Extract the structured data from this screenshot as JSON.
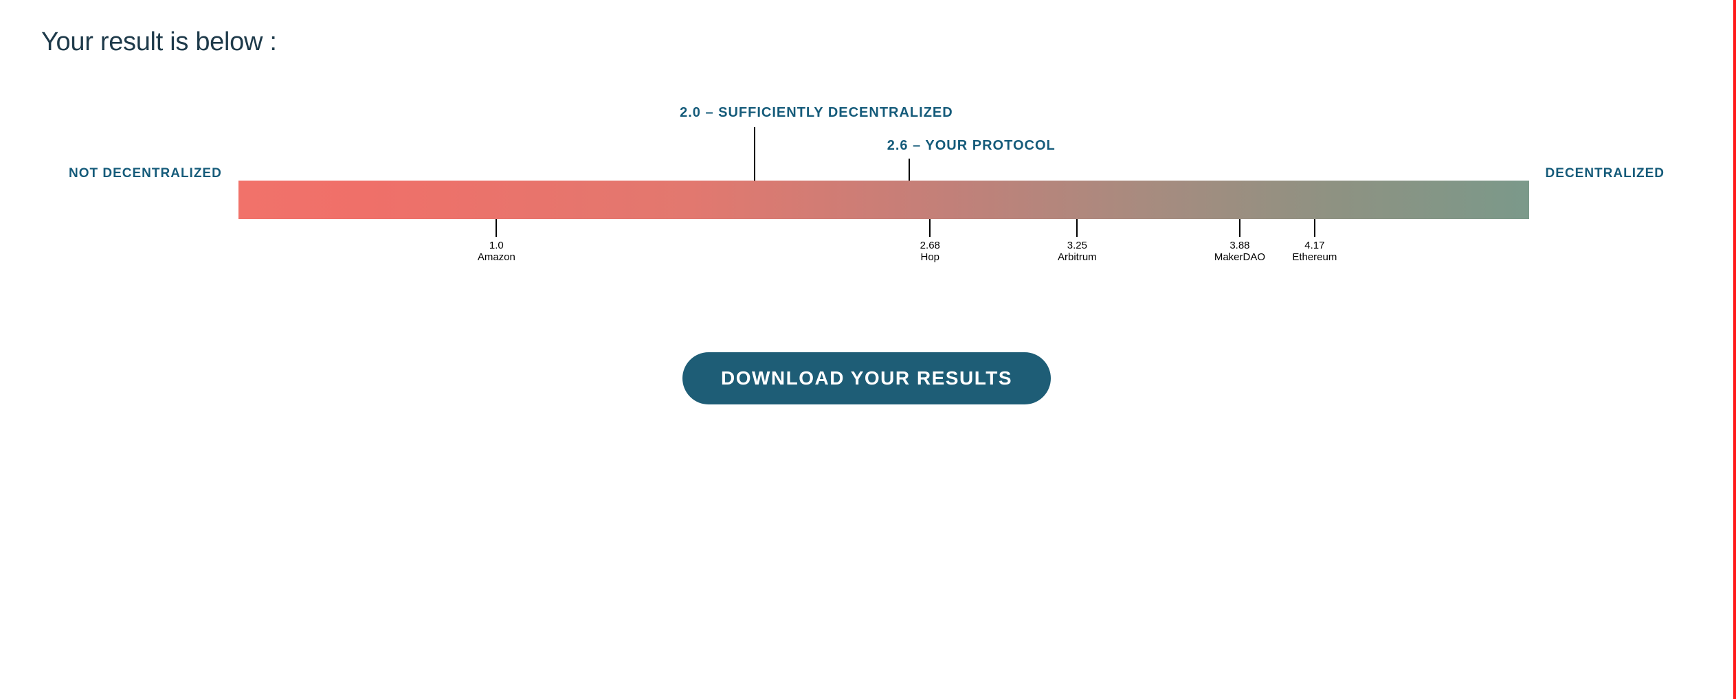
{
  "title": "Your result is below :",
  "scale": {
    "left_label": "NOT DECENTRALIZED",
    "right_label": "DECENTRALIZED",
    "min": 0,
    "max": 5
  },
  "above": [
    {
      "value": 2.0,
      "text": "2.0 – SUFFICIENTLY DECENTRALIZED",
      "level": 1
    },
    {
      "value": 2.6,
      "text": "2.6 – YOUR PROTOCOL",
      "level": 2
    }
  ],
  "below": [
    {
      "value": 1.0,
      "value_text": "1.0",
      "name": "Amazon"
    },
    {
      "value": 2.68,
      "value_text": "2.68",
      "name": "Hop"
    },
    {
      "value": 3.25,
      "value_text": "3.25",
      "name": "Arbitrum"
    },
    {
      "value": 3.88,
      "value_text": "3.88",
      "name": "MakerDAO"
    },
    {
      "value": 4.17,
      "value_text": "4.17",
      "name": "Ethereum"
    }
  ],
  "button": {
    "label": "DOWNLOAD YOUR RESULTS"
  },
  "chart_data": {
    "type": "bar",
    "title": "Your result is below :",
    "orientation": "horizontal-scale",
    "xlabel": "",
    "ylabel": "",
    "xlim": [
      0,
      5
    ],
    "annotations": [
      {
        "x": 2.0,
        "text": "2.0 – SUFFICIENTLY DECENTRALIZED",
        "side": "above"
      },
      {
        "x": 2.6,
        "text": "2.6 – YOUR PROTOCOL",
        "side": "above"
      }
    ],
    "series": [
      {
        "name": "reference_protocols",
        "points": [
          {
            "x": 1.0,
            "label": "Amazon"
          },
          {
            "x": 2.68,
            "label": "Hop"
          },
          {
            "x": 3.25,
            "label": "Arbitrum"
          },
          {
            "x": 3.88,
            "label": "MakerDAO"
          },
          {
            "x": 4.17,
            "label": "Ethereum"
          }
        ]
      }
    ],
    "axis_endpoints": {
      "left": "NOT DECENTRALIZED",
      "right": "DECENTRALIZED"
    }
  }
}
